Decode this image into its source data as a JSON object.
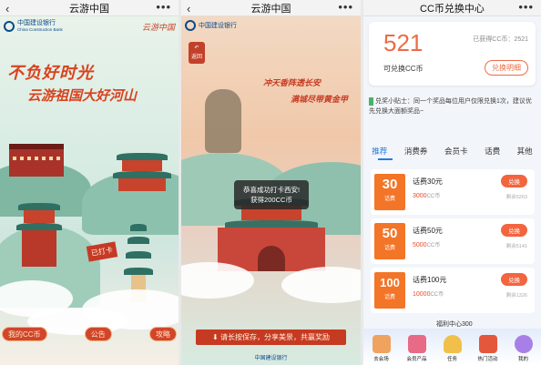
{
  "panels": {
    "left": {
      "title": "云游中国",
      "back_icon": "chevron-left-icon",
      "more_icon": "more-icon",
      "bank_name": "中国建设银行",
      "bank_name_en": "China Construction Bank",
      "campaign_logo": "云游中国",
      "headline1": "不负好时光",
      "headline2": "云游祖国大好河山",
      "stamp_text": "已打卡",
      "buttons": [
        "我的CC币",
        "公告",
        "攻略"
      ]
    },
    "middle": {
      "title": "云游中国",
      "back_icon": "chevron-left-icon",
      "more_icon": "more-icon",
      "bank_name": "中国建设银行",
      "back_button": "返回",
      "poem1": "冲天香阵透长安",
      "poem2": "满城尽带黄金甲",
      "toast_line1": "恭喜成功打卡西安!",
      "toast_line2": "获得200CC币",
      "share_banner": "请长按保存，分享美景，共赢奖励",
      "bottom_bank": "中国建设银行"
    },
    "right": {
      "title": "CC币兑换中心",
      "more_icon": "more-icon",
      "coins": "521",
      "coins_label": "可兑换CC币",
      "used_label": "已获得CC币：",
      "used_value": "2521",
      "detail_button": "兑换明细",
      "tip": "兑奖小贴士：同一个奖品每位用户仅限兑换1次，建议优先兑换大面额奖品~",
      "tabs": [
        "推荐",
        "消费券",
        "会员卡",
        "话费",
        "其他"
      ],
      "prizes": [
        {
          "badge": "30",
          "unit": "话费",
          "name": "话费30元",
          "cost": "3000",
          "cost_unit": "CC币",
          "button": "兑换",
          "stock": "剩余5263"
        },
        {
          "badge": "50",
          "unit": "话费",
          "name": "话费50元",
          "cost": "5000",
          "cost_unit": "CC币",
          "button": "兑换",
          "stock": "剩余5141"
        },
        {
          "badge": "100",
          "unit": "话费",
          "name": "话费100元",
          "cost": "10000",
          "cost_unit": "CC币",
          "button": "兑换",
          "stock": "剩余1326"
        }
      ],
      "floating_text": "福利中心300",
      "nav": [
        {
          "label": "去会场",
          "color": "#f0a35e"
        },
        {
          "label": "会员产品",
          "color": "#e86a87"
        },
        {
          "label": "任务",
          "color": "#f1c04b"
        },
        {
          "label": "热门活动",
          "color": "#e4573d"
        },
        {
          "label": "我的",
          "color": "#a87fe6"
        }
      ]
    }
  }
}
